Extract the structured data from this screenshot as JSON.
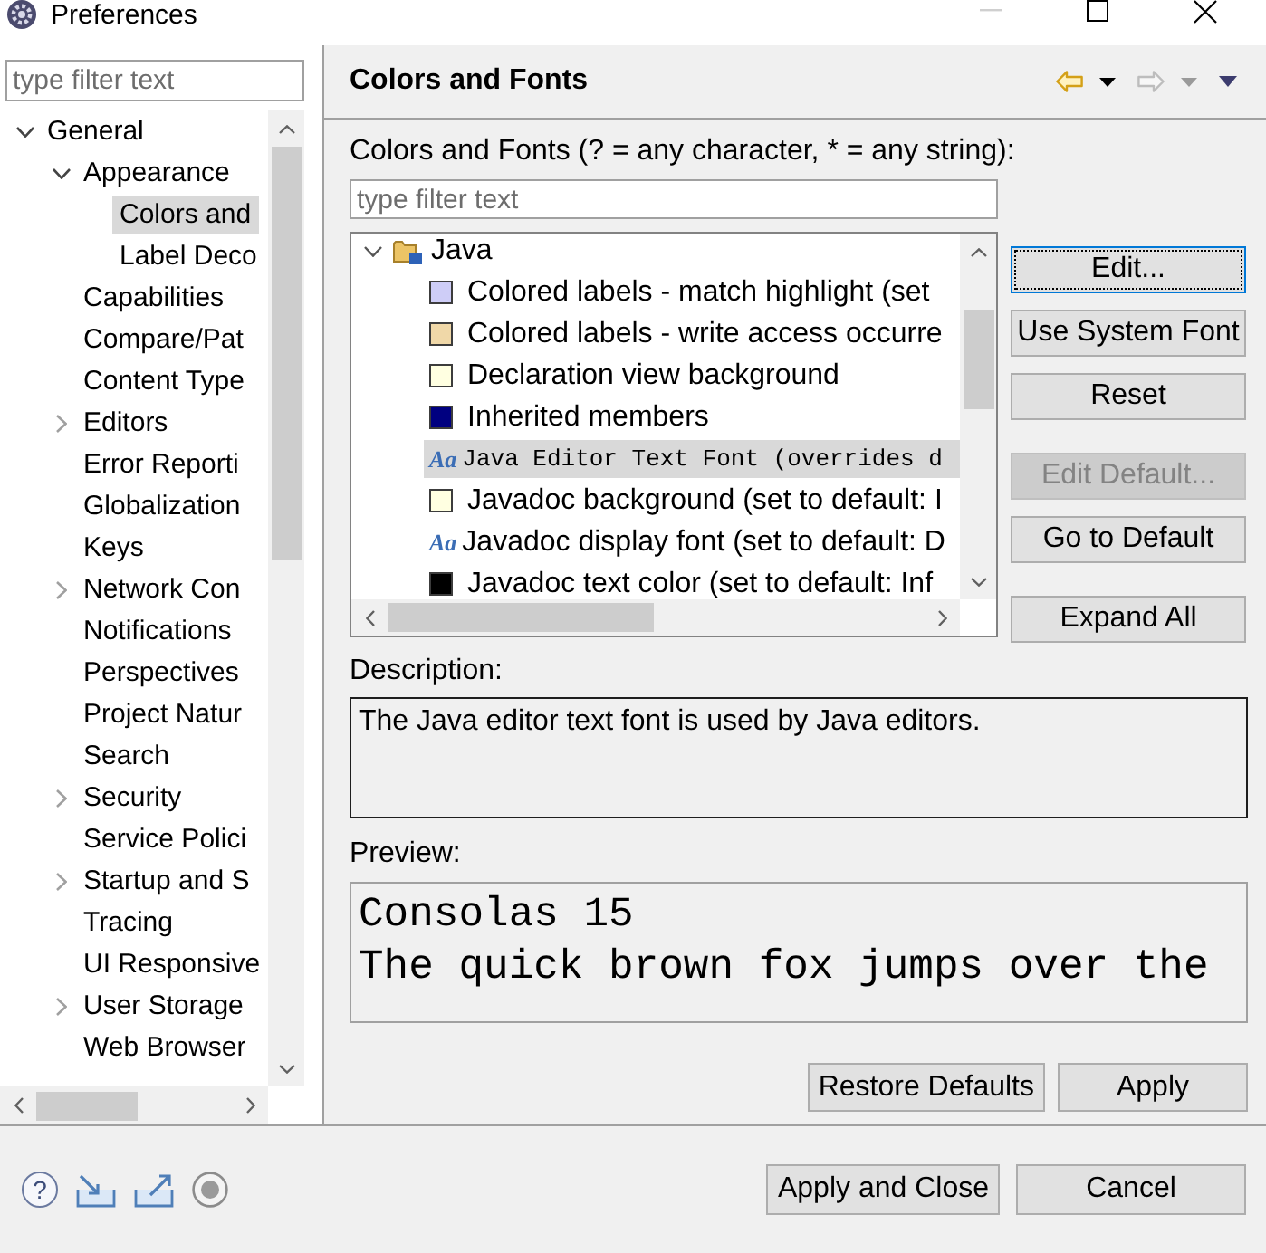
{
  "window": {
    "title": "Preferences",
    "controls": [
      {
        "kind": "minimize",
        "disabled": true
      },
      {
        "kind": "maximize",
        "disabled": false
      },
      {
        "kind": "close",
        "disabled": false
      }
    ]
  },
  "sidebar": {
    "filter": {
      "placeholder": "type filter text"
    },
    "tree": [
      {
        "label": "General",
        "expanded": true,
        "selected": false,
        "children": [
          {
            "label": "Appearance",
            "expanded": true,
            "selected": false,
            "children": [
              {
                "label": "Colors and",
                "selected": true
              },
              {
                "label": "Label Deco",
                "selected": false
              }
            ]
          },
          {
            "label": "Capabilities",
            "selected": false
          },
          {
            "label": "Compare/Pat",
            "selected": false
          },
          {
            "label": "Content Type",
            "selected": false
          },
          {
            "label": "Editors",
            "expanded": false,
            "selected": false
          },
          {
            "label": "Error Reporti",
            "selected": false
          },
          {
            "label": "Globalization",
            "selected": false
          },
          {
            "label": "Keys",
            "selected": false
          },
          {
            "label": "Network Con",
            "expanded": false,
            "selected": false
          },
          {
            "label": "Notifications",
            "selected": false
          },
          {
            "label": "Perspectives",
            "selected": false
          },
          {
            "label": "Project Natur",
            "selected": false
          },
          {
            "label": "Search",
            "selected": false
          },
          {
            "label": "Security",
            "expanded": false,
            "selected": false
          },
          {
            "label": "Service Polici",
            "selected": false
          },
          {
            "label": "Startup and S",
            "expanded": false,
            "selected": false
          },
          {
            "label": "Tracing",
            "selected": false
          },
          {
            "label": "UI Responsive",
            "selected": false
          },
          {
            "label": "User Storage",
            "expanded": false,
            "selected": false
          },
          {
            "label": "Web Browser",
            "selected": false
          }
        ]
      }
    ]
  },
  "page": {
    "title": "Colors and Fonts",
    "nav": [
      {
        "kind": "back",
        "disabled": false
      },
      {
        "kind": "forward",
        "disabled": true
      }
    ],
    "filter_label": "Colors and Fonts (? = any character, * = any string):",
    "filter": {
      "placeholder": "type filter text"
    },
    "tree": [
      {
        "label": "Java",
        "kind": "category",
        "expanded": true,
        "selected": false,
        "children": [
          {
            "label": "Colored labels - match highlight (set",
            "kind": "color",
            "color": "#cecdf7",
            "selected": false
          },
          {
            "label": "Colored labels - write access occurre",
            "kind": "color",
            "color": "#f0d8a8",
            "selected": false
          },
          {
            "label": "Declaration view background",
            "kind": "color",
            "color": "#ffffe1",
            "selected": false
          },
          {
            "label": "Inherited members",
            "kind": "color",
            "color": "#000080",
            "selected": false
          },
          {
            "label": "Java Editor Text Font (overrides d",
            "kind": "code-font",
            "icon": "Aa",
            "selected": true
          },
          {
            "label": "Javadoc background (set to default: I",
            "kind": "color",
            "color": "#ffffe1",
            "selected": false
          },
          {
            "label": "Javadoc display font (set to default: D",
            "kind": "font",
            "icon": "Aa",
            "selected": false
          },
          {
            "label": "Javadoc text color (set to default: Inf",
            "kind": "color",
            "color": "#000000",
            "selected": false
          }
        ]
      }
    ],
    "button_groups": [
      [
        {
          "label": "Edit...",
          "focused": true,
          "disabled": false
        },
        {
          "label": "Use System Font",
          "focused": false,
          "disabled": false
        },
        {
          "label": "Reset",
          "focused": false,
          "disabled": false
        }
      ],
      [
        {
          "label": "Edit Default...",
          "focused": false,
          "disabled": true
        },
        {
          "label": "Go to Default",
          "focused": false,
          "disabled": false
        }
      ],
      [
        {
          "label": "Expand All",
          "focused": false,
          "disabled": false
        }
      ]
    ],
    "description_label": "Description:",
    "description": "The Java editor text font is used by Java editors.",
    "preview_label": "Preview:",
    "preview_lines": [
      "Consolas 15",
      "The quick brown fox jumps over the"
    ],
    "buttons": [
      {
        "label": "Restore Defaults"
      },
      {
        "label": "Apply"
      }
    ]
  },
  "footer": {
    "help": "?",
    "buttons": [
      {
        "label": "Apply and Close"
      },
      {
        "label": "Cancel"
      }
    ]
  }
}
